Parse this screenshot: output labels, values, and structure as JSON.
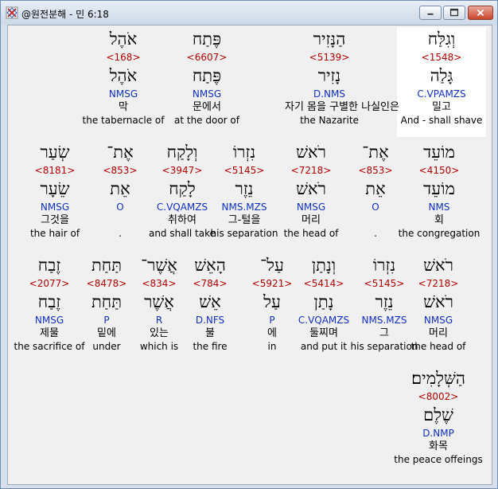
{
  "window": {
    "title": "@원전분해 - 민 6:18",
    "buttons": [
      "minimize",
      "maximize",
      "close"
    ]
  },
  "colors": {
    "strongs": "#b00000",
    "parsing": "#1030c0",
    "text": "#000000",
    "panel": "#f0f0f0",
    "highlight": "#ffffff"
  },
  "words": [
    {
      "hebrew": "וְגִלַּח",
      "strongs": "<1548>",
      "lemma": "גָּלַה",
      "parsing": "C.VPAMZS",
      "korean": "밀고",
      "english": "And - shall shave",
      "highlighted": true
    },
    {
      "hebrew": "הַנָּזִיר",
      "strongs": "<5139>",
      "lemma": "נָזִיר",
      "parsing": "D.NMS",
      "korean": "자기 몸을 구별한 나실인은",
      "english": "the Nazarite",
      "highlighted": false
    },
    {
      "hebrew": "פֶּתַח",
      "strongs": "<6607>",
      "lemma": "פֶּתַח",
      "parsing": "NMSG",
      "korean": "문에서",
      "english": "at the door of",
      "highlighted": false
    },
    {
      "hebrew": "אֹהֶל",
      "strongs": "<168>",
      "lemma": "אֹהֶל",
      "parsing": "NMSG",
      "korean": "막",
      "english": "the tabernacle of",
      "highlighted": false
    },
    {
      "hebrew": "מוֹעֵד",
      "strongs": "<4150>",
      "lemma": "מוֹעֵד",
      "parsing": "NMS",
      "korean": "회",
      "english": "the congregation",
      "highlighted": false
    },
    {
      "hebrew": "אֶת־",
      "strongs": "<853>",
      "lemma": "אֵת",
      "parsing": "O",
      "korean": "",
      "english": ".",
      "highlighted": false
    },
    {
      "hebrew": "רֹאשׁ",
      "strongs": "<7218>",
      "lemma": "רֹאשׁ",
      "parsing": "NMSG",
      "korean": "머리",
      "english": "the head of",
      "highlighted": false
    },
    {
      "hebrew": "נִזְרוֹ",
      "strongs": "<5145>",
      "lemma": "נֵזֶר",
      "parsing": "NMS.MZS",
      "korean": "그-털을",
      "english": "his separation",
      "highlighted": false
    },
    {
      "hebrew": "וְלָקַח",
      "strongs": "<3947>",
      "lemma": "לָקַח",
      "parsing": "C.VQAMZS",
      "korean": "취하여",
      "english": "and shall take",
      "highlighted": false
    },
    {
      "hebrew": "אֶת־",
      "strongs": "<853>",
      "lemma": "אֵת",
      "parsing": "O",
      "korean": "",
      "english": ".",
      "highlighted": false
    },
    {
      "hebrew": "שְׂעַר",
      "strongs": "<8181>",
      "lemma": "שֵׂעָר",
      "parsing": "NMSG",
      "korean": "그것을",
      "english": "the hair of",
      "highlighted": false
    },
    {
      "hebrew": "רֹאשׁ",
      "strongs": "<7218>",
      "lemma": "רֹאשׁ",
      "parsing": "NMSG",
      "korean": "머리",
      "english": "the head of",
      "highlighted": false
    },
    {
      "hebrew": "נִזְרוֹ",
      "strongs": "<5145>",
      "lemma": "נֵזֶר",
      "parsing": "NMS.MZS",
      "korean": "그",
      "english": "his separation",
      "highlighted": false
    },
    {
      "hebrew": "וְנָתַן",
      "strongs": "<5414>",
      "lemma": "נָתַן",
      "parsing": "C.VQAMZS",
      "korean": "둘찌며",
      "english": "and put it",
      "highlighted": false
    },
    {
      "hebrew": "עַל־",
      "strongs": "<5921>",
      "lemma": "עַל",
      "parsing": "P",
      "korean": "에",
      "english": "in",
      "highlighted": false
    },
    {
      "hebrew": "הָאֵשׁ",
      "strongs": "<784>",
      "lemma": "אֵשׁ",
      "parsing": "D.NFS",
      "korean": "불",
      "english": "the fire",
      "highlighted": false
    },
    {
      "hebrew": "אֲשֶׁר־",
      "strongs": "<834>",
      "lemma": "אֲשֶׁר",
      "parsing": "R",
      "korean": "있는",
      "english": "which is",
      "highlighted": false
    },
    {
      "hebrew": "תַּחַת",
      "strongs": "<8478>",
      "lemma": "תַּחַת",
      "parsing": "P",
      "korean": "밑에",
      "english": "under",
      "highlighted": false
    },
    {
      "hebrew": "זֶבַח",
      "strongs": "<2077>",
      "lemma": "זֶבַח",
      "parsing": "NMSG",
      "korean": "제물",
      "english": "the sacrifice of",
      "highlighted": false
    },
    {
      "hebrew": "הַשְּׁלָמִים׃",
      "strongs": "<8002>",
      "lemma": "שֶׁלֶם",
      "parsing": "D.NMP",
      "korean": "화목",
      "english": "the peace offeings",
      "highlighted": false
    }
  ]
}
